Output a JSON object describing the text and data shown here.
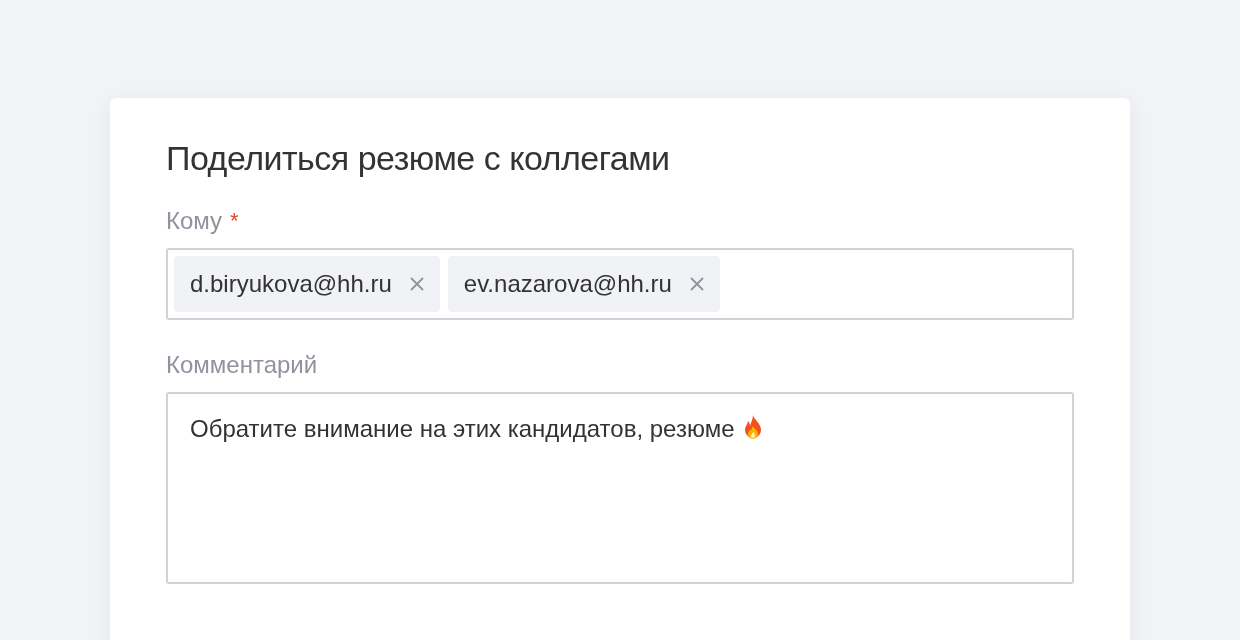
{
  "dialog": {
    "title": "Поделиться резюме с коллегами"
  },
  "recipients": {
    "label": "Кому",
    "required": true,
    "required_mark": "*",
    "tags": [
      {
        "email": "d.biryukova@hh.ru"
      },
      {
        "email": "ev.nazarova@hh.ru"
      }
    ]
  },
  "comment": {
    "label": "Комментарий",
    "value": "Обратите внимание на этих кандидатов, резюме",
    "fire_icon": true
  }
}
